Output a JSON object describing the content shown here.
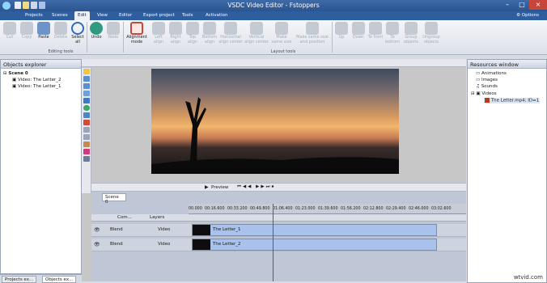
{
  "window": {
    "title": "VSDC Video Editor - Fstoppers"
  },
  "menu": {
    "items": [
      "Projects",
      "Scenes",
      "Edit",
      "View",
      "Editor",
      "Export project",
      "Tools",
      "Activation"
    ],
    "active": "Edit",
    "options": "Options"
  },
  "ribbon": {
    "buttons": [
      "Cut",
      "Copy",
      "Paste",
      "Delete",
      "Select all",
      "Undo",
      "Redo",
      "Alignment mode",
      "Left align",
      "Right align",
      "Top align",
      "Bottom align",
      "Horizontal align center",
      "Vertical align center",
      "Make same size",
      "Make same size and position",
      "Up",
      "Down",
      "To front",
      "To bottom",
      "Group objects",
      "Ungroup objects"
    ],
    "groups": [
      "Editing tools",
      "Layout tools"
    ]
  },
  "objects_explorer": {
    "title": "Objects explorer",
    "scene": "Scene 0",
    "items": [
      "Video: The Letter_2",
      "Video: The Letter_1"
    ]
  },
  "resources": {
    "title": "Resources window",
    "items": [
      "Animations",
      "Images",
      "Sounds",
      "Videos"
    ],
    "video_file": "The Letter.mp4; ID=1"
  },
  "timeline": {
    "preview_label": "Preview",
    "scene_tab": "Scene 0",
    "ticks": [
      "00.000",
      "00:16.600",
      "00:33.200",
      "00:49.800",
      "01:06.400",
      "01:23.000",
      "01:39.600",
      "01:56.200",
      "02:12.800",
      "02:29.400",
      "02:46.000",
      "03:02.600"
    ],
    "col_com": "Com...",
    "col_layers": "Layers",
    "tracks": [
      {
        "blend": "Blend",
        "type": "Video",
        "clip": "The Letter_1"
      },
      {
        "blend": "Blend",
        "type": "Video",
        "clip": "The Letter_2"
      }
    ]
  },
  "status_tabs": [
    "Projects ex...",
    "Objects ex..."
  ],
  "watermark": "wtvid.com"
}
